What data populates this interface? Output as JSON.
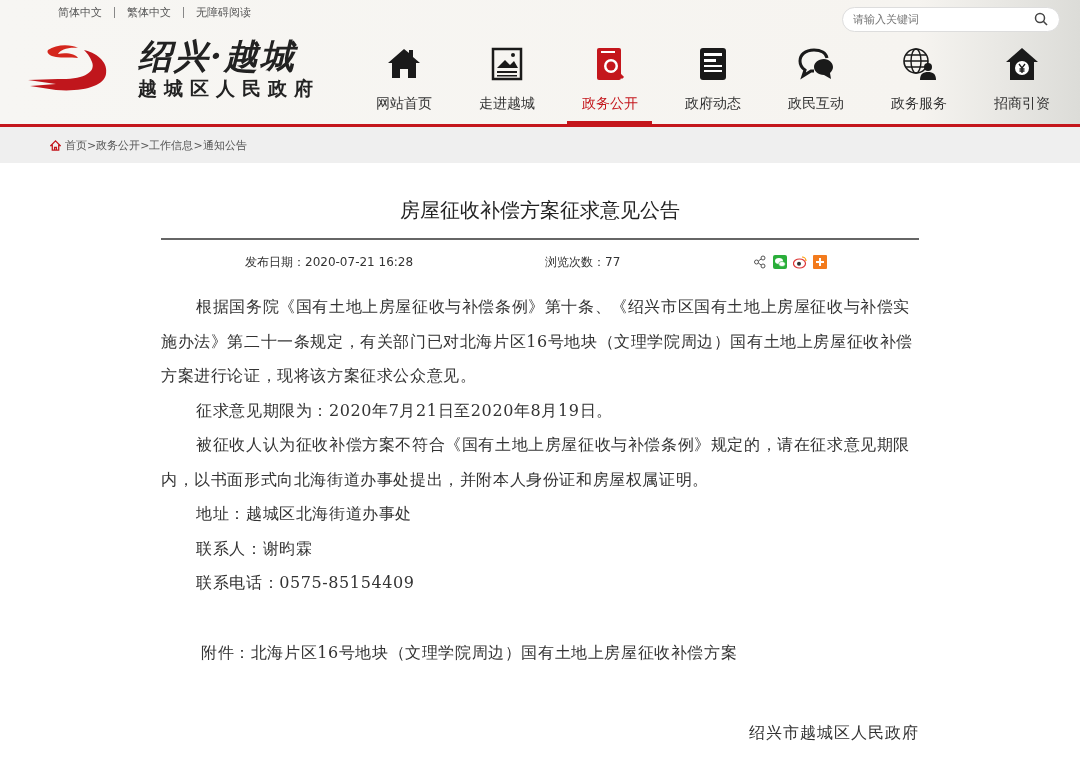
{
  "top_links": [
    "简体中文",
    "繁体中文",
    "无障碍阅读"
  ],
  "logo": {
    "title": "绍兴·越城",
    "subtitle": "越城区人民政府"
  },
  "search": {
    "placeholder": "请输入关键词"
  },
  "nav": [
    {
      "label": "网站首页",
      "kind": "home",
      "selected": false
    },
    {
      "label": "走进越城",
      "kind": "picture",
      "selected": false
    },
    {
      "label": "政务公开",
      "kind": "search-doc",
      "selected": true
    },
    {
      "label": "政府动态",
      "kind": "document",
      "selected": false
    },
    {
      "label": "政民互动",
      "kind": "chat",
      "selected": false
    },
    {
      "label": "政务服务",
      "kind": "globe",
      "selected": false
    },
    {
      "label": "招商引资",
      "kind": "yen",
      "selected": false
    }
  ],
  "breadcrumb": "首页>政务公开>工作信息>通知公告",
  "article": {
    "title": "房屋征收补偿方案征求意见公告",
    "date": "发布日期：2020-07-21 16:28",
    "views": "浏览次数：77",
    "paragraphs": [
      "根据国务院《国有土地上房屋征收与补偿条例》第十条、《绍兴市区国有土地上房屋征收与补偿实施办法》第二十一条规定，有关部门已对北海片区16号地块（文理学院周边）国有土地上房屋征收补偿方案进行论证，现将该方案征求公众意见。",
      "征求意见期限为：2020年7月21日至2020年8月19日。",
      "被征收人认为征收补偿方案不符合《国有土地上房屋征收与补偿条例》规定的，请在征求意见期限内，以书面形式向北海街道办事处提出，并附本人身份证和房屋权属证明。",
      "地址：越城区北海街道办事处",
      "联系人：谢昀霖",
      "联系电话：0575-85154409"
    ],
    "attachment": "附件：北海片区16号地块（文理学院周边）国有土地上房屋征收补偿方案",
    "signature": "绍兴市越城区人民政府"
  }
}
